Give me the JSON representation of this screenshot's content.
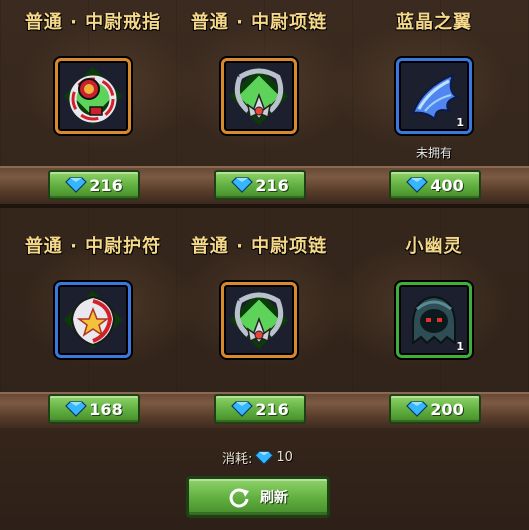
{
  "shop": {
    "items": [
      {
        "name": "普通 · 中尉戒指",
        "price": "216",
        "icon": "ring-icon",
        "frame": "orange"
      },
      {
        "name": "普通 · 中尉项链",
        "price": "216",
        "icon": "necklace-icon",
        "frame": "orange"
      },
      {
        "name": "蓝晶之翼",
        "price": "400",
        "icon": "blue-wing-icon",
        "frame": "blue",
        "quantity": "1",
        "status": "未拥有"
      },
      {
        "name": "普通 · 中尉护符",
        "price": "168",
        "icon": "amulet-icon",
        "frame": "blue"
      },
      {
        "name": "普通 · 中尉项链",
        "price": "216",
        "icon": "necklace-icon",
        "frame": "orange"
      },
      {
        "name": "小幽灵",
        "price": "200",
        "icon": "ghost-pet-icon",
        "frame": "green",
        "quantity": "1"
      }
    ],
    "cost_label": "消耗:",
    "cost_value": "10",
    "refresh_label": "刷新"
  },
  "colors": {
    "title": "#f6d88a",
    "button_green": "#5fae3e",
    "frame_orange": "#d8892a",
    "frame_blue": "#3a78e0",
    "frame_green": "#3fae3c",
    "gem_blue": "#36b6ff"
  }
}
